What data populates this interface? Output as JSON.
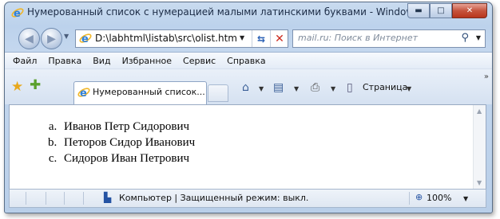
{
  "window": {
    "title": "Нумерованный список с нумерацией малыми латинскими буквами - Windows Inte...",
    "btn_minimize": "▬",
    "btn_maximize": "□",
    "btn_close": "✕"
  },
  "nav": {
    "back": "◀",
    "forward": "▶",
    "address": "D:\\labhtml\\listab\\src\\olist.htm",
    "search_placeholder": "mail.ru: Поиск в Интернет"
  },
  "menu": [
    "Файл",
    "Правка",
    "Вид",
    "Избранное",
    "Сервис",
    "Справка"
  ],
  "tab": {
    "label": "Нумерованный список..."
  },
  "toolbar": {
    "page_label": "Страница"
  },
  "content": {
    "list_type": "lower-alpha",
    "items": [
      "Иванов Петр Сидорович",
      "Петоров Сидор Иванович",
      "Сидоров Иван Петрович"
    ]
  },
  "status": {
    "text": "Компьютер | Защищенный режим: выкл.",
    "zoom": "100%"
  },
  "colors": {
    "frame": "#bcd2ec",
    "close_button": "#c6543d",
    "ie_icon": "#2f80d8"
  }
}
